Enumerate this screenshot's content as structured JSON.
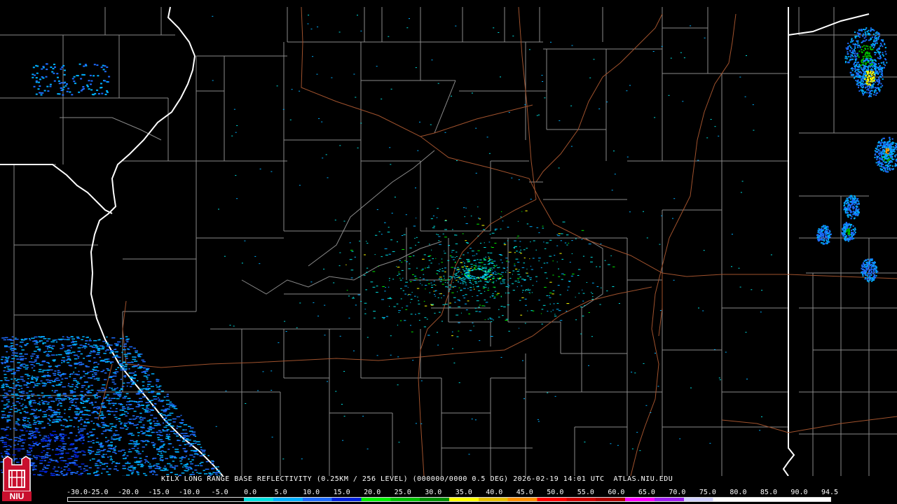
{
  "product": {
    "caption": "KILX LONG RANGE BASE REFLECTIVITY (0.25KM / 256 LEVEL) (000000/0000 0.5 DEG) 2026-02-19 14:01 UTC  ATLAS.NIU.EDU"
  },
  "logo": {
    "text": "NIU",
    "colors": {
      "fill": "#c8102e",
      "emblem": "#ffffff"
    }
  },
  "colors": {
    "background": "#000000",
    "county_lines": "#8a8a8a",
    "state_lines": "#ffffff",
    "highways": "#a0522d"
  },
  "legend": {
    "labels": [
      "-30.0",
      "-25.0",
      "-20.0",
      "-15.0",
      "-10.0",
      "-5.0",
      "0.0",
      "5.0",
      "10.0",
      "15.0",
      "20.0",
      "25.0",
      "30.0",
      "35.0",
      "40.0",
      "45.0",
      "50.0",
      "55.0",
      "60.0",
      "65.0",
      "70.0",
      "75.0",
      "80.0",
      "85.0",
      "90.0",
      "94.5"
    ],
    "colors": [
      "#000000",
      "#000000",
      "#000000",
      "#000000",
      "#000000",
      "#000000",
      "#00e0e0",
      "#00b0ff",
      "#1e6cff",
      "#0022dd",
      "#00f000",
      "#00c000",
      "#009000",
      "#ffff00",
      "#e6c000",
      "#ff9000",
      "#ff0000",
      "#d00000",
      "#b00000",
      "#ff00ff",
      "#a020f0",
      "#d0d0ff",
      "#ffffff",
      "#ffffff",
      "#ffffff",
      "#ffffff"
    ]
  }
}
